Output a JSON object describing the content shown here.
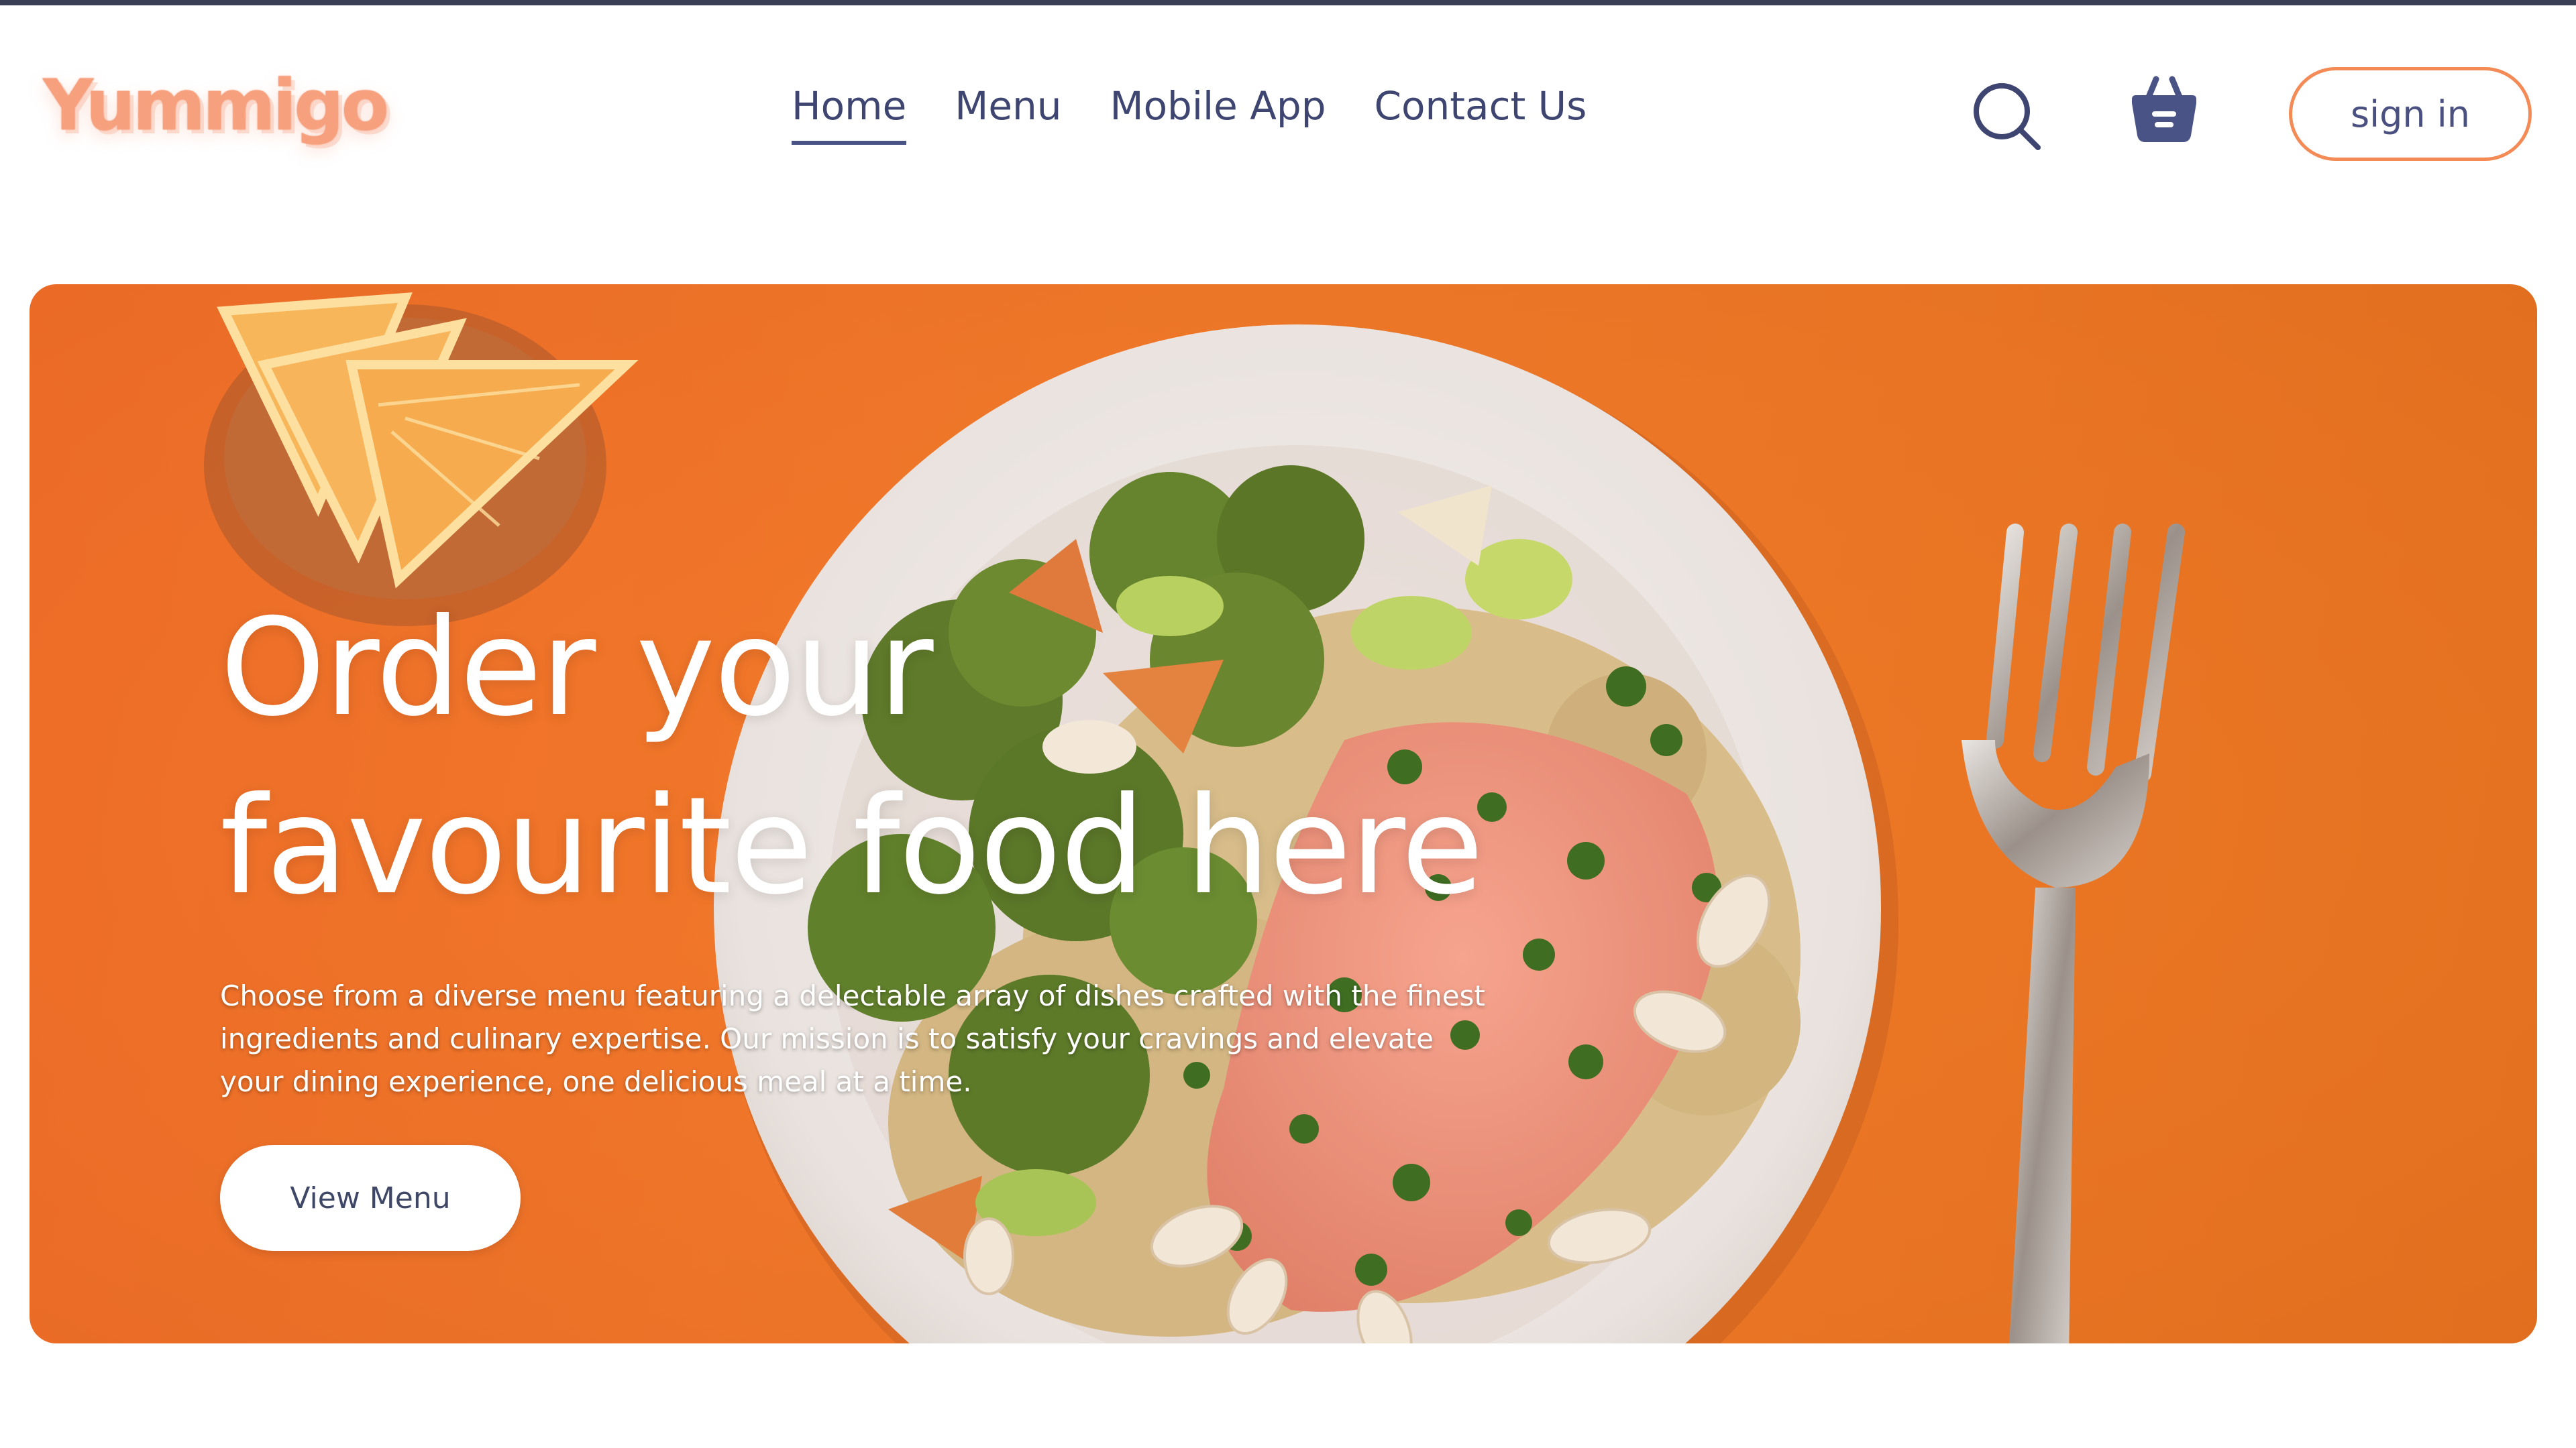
{
  "brand": {
    "logo_text": "Yummigo"
  },
  "nav": {
    "links": [
      {
        "label": "Home",
        "active": true
      },
      {
        "label": "Menu",
        "active": false
      },
      {
        "label": "Mobile App",
        "active": false
      },
      {
        "label": "Contact Us",
        "active": false
      }
    ],
    "icons": {
      "search": "search-icon",
      "basket": "basket-icon"
    },
    "signin_label": "sign in"
  },
  "hero": {
    "title_line1": "Order your",
    "title_line2": "favourite food here",
    "description": "Choose from a diverse menu featuring a delectable array of dishes crafted with the finest ingredients and culinary expertise. Our mission is to satisfy your cravings and elevate your dining experience, one delicious meal at a time.",
    "cta_label": "View Menu"
  },
  "colors": {
    "accent": "#f4702a",
    "logo": "#f6a07e",
    "nav_text": "#3d4570",
    "signin_border": "#f48a55"
  }
}
